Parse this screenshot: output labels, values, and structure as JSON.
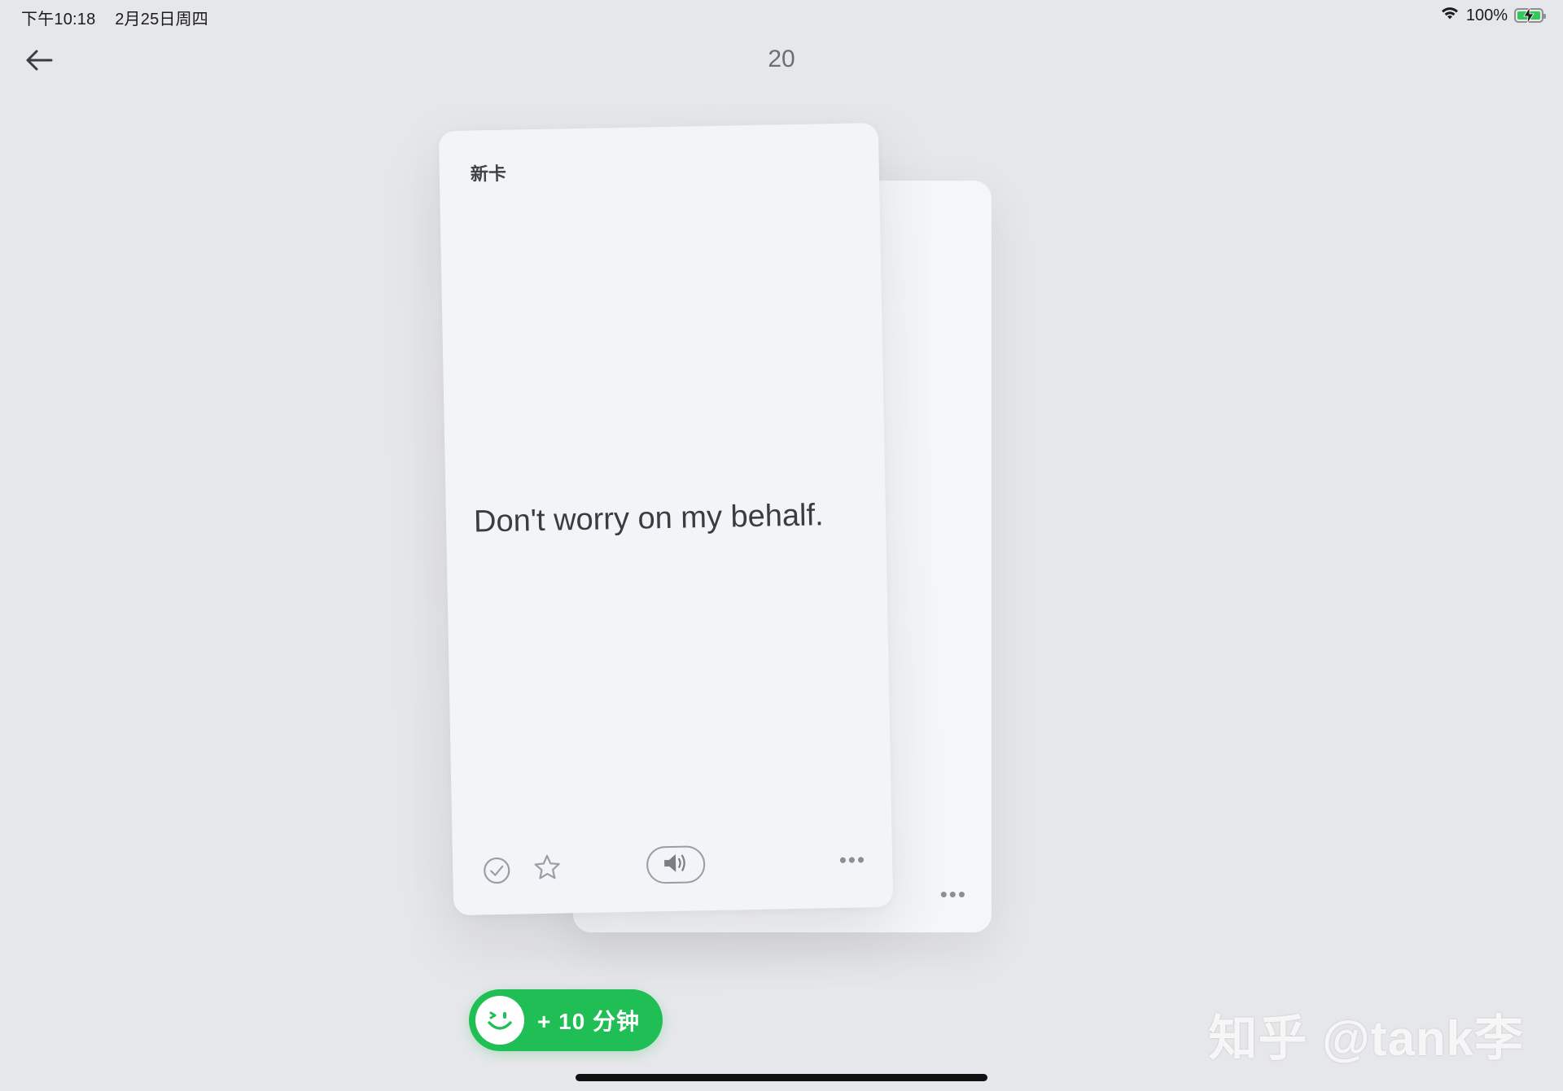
{
  "status_bar": {
    "time": "下午10:18",
    "date": "2月25日周四",
    "battery_percent": "100%",
    "battery_level": 1.0,
    "wifi_icon": "wifi-icon",
    "battery_icon": "battery-charging-icon"
  },
  "nav": {
    "back_icon": "arrow-left-icon",
    "count": "20"
  },
  "card": {
    "tag": "新卡",
    "text": "Don't worry on my behalf.",
    "toolbar_icons": [
      "check-circle-icon",
      "star-icon",
      "speaker-icon",
      "more-icon"
    ],
    "more_label": "•••"
  },
  "back_card": {
    "more_label": "•••"
  },
  "timer": {
    "label": "+ 10 分钟",
    "icon": "smile-face-icon"
  },
  "watermark": "知乎 @tank李",
  "colors": {
    "background": "#e6e7ea",
    "card": "#f2f5f8",
    "accent_green": "#1fbf55",
    "battery_green": "#34c759"
  }
}
